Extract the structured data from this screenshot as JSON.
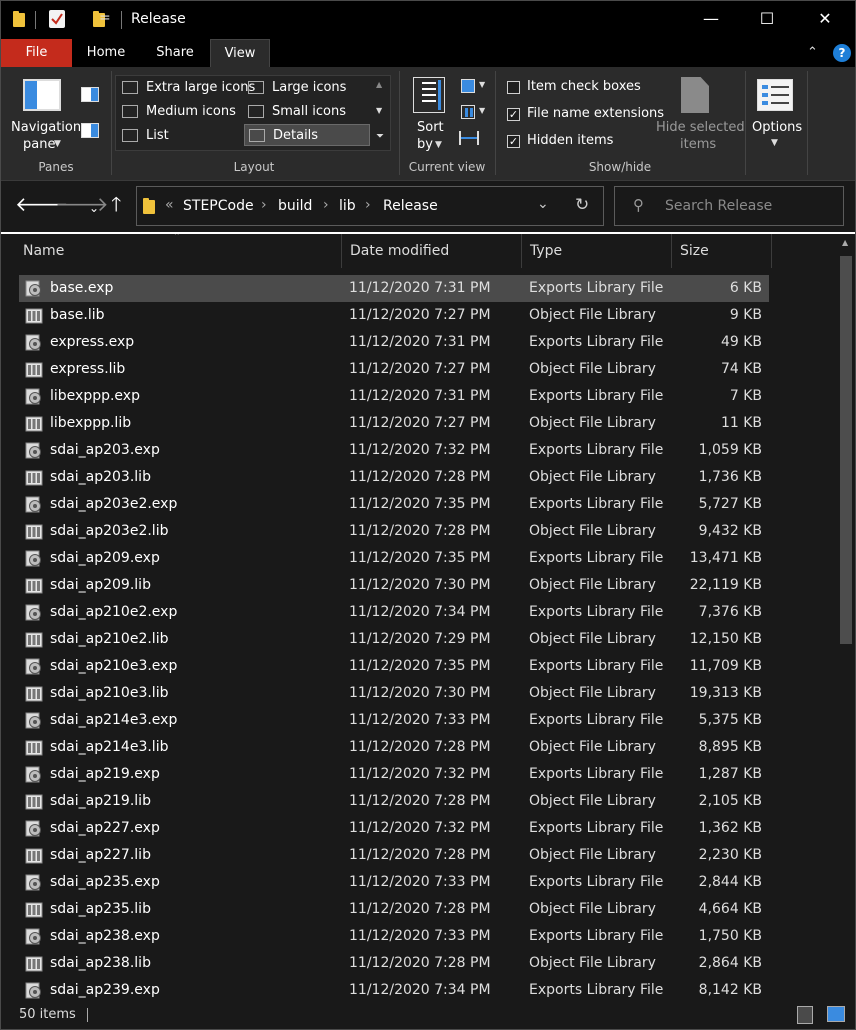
{
  "window": {
    "title": "Release",
    "quick_access_down": "=",
    "minimize": "—",
    "maximize": "☐",
    "close": "✕"
  },
  "tabs": [
    {
      "label": "File"
    },
    {
      "label": "Home"
    },
    {
      "label": "Share"
    },
    {
      "label": "View"
    }
  ],
  "ribbon": {
    "panes": {
      "nav_pane_line1": "Navigation",
      "nav_pane_line2": "pane",
      "label": "Panes"
    },
    "layout": {
      "label": "Layout",
      "items": [
        "Extra large icons",
        "Large icons",
        "Medium icons",
        "Small icons",
        "List",
        "Details"
      ]
    },
    "current_view": {
      "sort_line1": "Sort",
      "sort_line2": "by",
      "label": "Current view"
    },
    "show_hide": {
      "item_check_boxes": "Item check boxes",
      "file_name_extensions": "File name extensions",
      "hidden_items": "Hidden items",
      "hide_selected_line1": "Hide selected",
      "hide_selected_line2": "items",
      "label": "Show/hide"
    },
    "options": "Options",
    "help": "?"
  },
  "address": {
    "overflow": "«",
    "crumbs": [
      "STEPCode",
      "build",
      "lib",
      "Release"
    ]
  },
  "search": {
    "placeholder": "Search Release"
  },
  "columns": [
    "Name",
    "Date modified",
    "Type",
    "Size"
  ],
  "files": [
    {
      "name": "base.exp",
      "date": "11/12/2020 7:31 PM",
      "type": "Exports Library File",
      "size": "6 KB",
      "icon": "gear-icon"
    },
    {
      "name": "base.lib",
      "date": "11/12/2020 7:27 PM",
      "type": "Object File Library",
      "size": "9 KB",
      "icon": "library-icon"
    },
    {
      "name": "express.exp",
      "date": "11/12/2020 7:31 PM",
      "type": "Exports Library File",
      "size": "49 KB",
      "icon": "gear-icon"
    },
    {
      "name": "express.lib",
      "date": "11/12/2020 7:27 PM",
      "type": "Object File Library",
      "size": "74 KB",
      "icon": "library-icon"
    },
    {
      "name": "libexppp.exp",
      "date": "11/12/2020 7:31 PM",
      "type": "Exports Library File",
      "size": "7 KB",
      "icon": "gear-icon"
    },
    {
      "name": "libexppp.lib",
      "date": "11/12/2020 7:27 PM",
      "type": "Object File Library",
      "size": "11 KB",
      "icon": "library-icon"
    },
    {
      "name": "sdai_ap203.exp",
      "date": "11/12/2020 7:32 PM",
      "type": "Exports Library File",
      "size": "1,059 KB",
      "icon": "gear-icon"
    },
    {
      "name": "sdai_ap203.lib",
      "date": "11/12/2020 7:28 PM",
      "type": "Object File Library",
      "size": "1,736 KB",
      "icon": "library-icon"
    },
    {
      "name": "sdai_ap203e2.exp",
      "date": "11/12/2020 7:35 PM",
      "type": "Exports Library File",
      "size": "5,727 KB",
      "icon": "gear-icon"
    },
    {
      "name": "sdai_ap203e2.lib",
      "date": "11/12/2020 7:28 PM",
      "type": "Object File Library",
      "size": "9,432 KB",
      "icon": "library-icon"
    },
    {
      "name": "sdai_ap209.exp",
      "date": "11/12/2020 7:35 PM",
      "type": "Exports Library File",
      "size": "13,471 KB",
      "icon": "gear-icon"
    },
    {
      "name": "sdai_ap209.lib",
      "date": "11/12/2020 7:30 PM",
      "type": "Object File Library",
      "size": "22,119 KB",
      "icon": "library-icon"
    },
    {
      "name": "sdai_ap210e2.exp",
      "date": "11/12/2020 7:34 PM",
      "type": "Exports Library File",
      "size": "7,376 KB",
      "icon": "gear-icon"
    },
    {
      "name": "sdai_ap210e2.lib",
      "date": "11/12/2020 7:29 PM",
      "type": "Object File Library",
      "size": "12,150 KB",
      "icon": "library-icon"
    },
    {
      "name": "sdai_ap210e3.exp",
      "date": "11/12/2020 7:35 PM",
      "type": "Exports Library File",
      "size": "11,709 KB",
      "icon": "gear-icon"
    },
    {
      "name": "sdai_ap210e3.lib",
      "date": "11/12/2020 7:30 PM",
      "type": "Object File Library",
      "size": "19,313 KB",
      "icon": "library-icon"
    },
    {
      "name": "sdai_ap214e3.exp",
      "date": "11/12/2020 7:33 PM",
      "type": "Exports Library File",
      "size": "5,375 KB",
      "icon": "gear-icon"
    },
    {
      "name": "sdai_ap214e3.lib",
      "date": "11/12/2020 7:28 PM",
      "type": "Object File Library",
      "size": "8,895 KB",
      "icon": "library-icon"
    },
    {
      "name": "sdai_ap219.exp",
      "date": "11/12/2020 7:32 PM",
      "type": "Exports Library File",
      "size": "1,287 KB",
      "icon": "gear-icon"
    },
    {
      "name": "sdai_ap219.lib",
      "date": "11/12/2020 7:28 PM",
      "type": "Object File Library",
      "size": "2,105 KB",
      "icon": "library-icon"
    },
    {
      "name": "sdai_ap227.exp",
      "date": "11/12/2020 7:32 PM",
      "type": "Exports Library File",
      "size": "1,362 KB",
      "icon": "gear-icon"
    },
    {
      "name": "sdai_ap227.lib",
      "date": "11/12/2020 7:28 PM",
      "type": "Object File Library",
      "size": "2,230 KB",
      "icon": "library-icon"
    },
    {
      "name": "sdai_ap235.exp",
      "date": "11/12/2020 7:33 PM",
      "type": "Exports Library File",
      "size": "2,844 KB",
      "icon": "gear-icon"
    },
    {
      "name": "sdai_ap235.lib",
      "date": "11/12/2020 7:28 PM",
      "type": "Object File Library",
      "size": "4,664 KB",
      "icon": "library-icon"
    },
    {
      "name": "sdai_ap238.exp",
      "date": "11/12/2020 7:33 PM",
      "type": "Exports Library File",
      "size": "1,750 KB",
      "icon": "gear-icon"
    },
    {
      "name": "sdai_ap238.lib",
      "date": "11/12/2020 7:28 PM",
      "type": "Object File Library",
      "size": "2,864 KB",
      "icon": "library-icon"
    },
    {
      "name": "sdai_ap239.exp",
      "date": "11/12/2020 7:34 PM",
      "type": "Exports Library File",
      "size": "8,142 KB",
      "icon": "gear-icon"
    }
  ],
  "status": {
    "item_count": "50 items"
  },
  "colors": {
    "file_tab": "#c42b1c",
    "folder": "#f0c23b",
    "selection": "#4b4b4b",
    "help": "#1e7fd8"
  }
}
